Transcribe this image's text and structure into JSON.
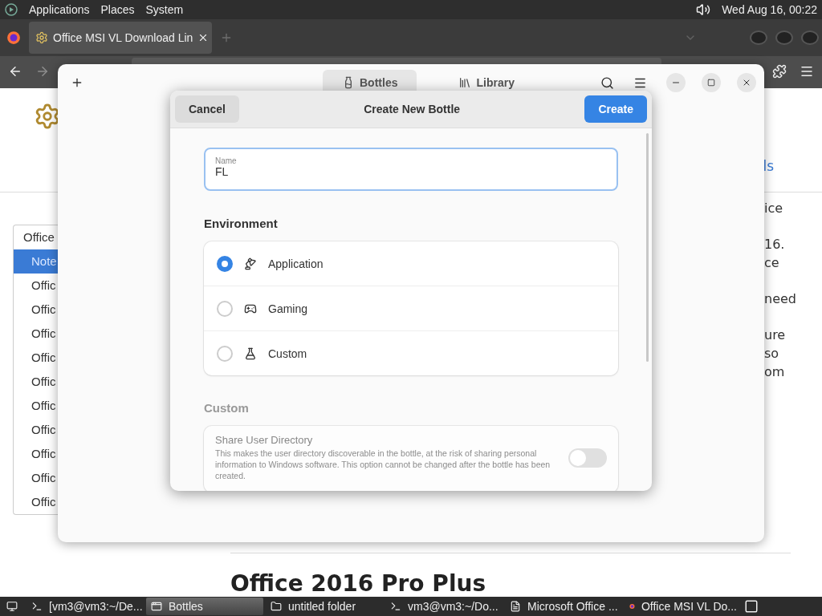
{
  "top_panel": {
    "menus": [
      "Applications",
      "Places",
      "System"
    ],
    "clock": "Wed Aug 16, 00:22"
  },
  "browser": {
    "tabs": [
      {
        "title": "Office MSI VL Download Lin",
        "selected": true
      }
    ],
    "page": {
      "link": "ls",
      "list": [
        {
          "label": "Office",
          "kind": "group",
          "selected": false
        },
        {
          "label": "Note",
          "kind": "option",
          "selected": true
        },
        {
          "label": "Offic",
          "kind": "option",
          "selected": false
        },
        {
          "label": "Offic",
          "kind": "option",
          "selected": false
        },
        {
          "label": "Offic",
          "kind": "option",
          "selected": false
        },
        {
          "label": "Offic",
          "kind": "option",
          "selected": false
        },
        {
          "label": "Offic",
          "kind": "option",
          "selected": false
        },
        {
          "label": "Offic",
          "kind": "option",
          "selected": false
        },
        {
          "label": "Offic",
          "kind": "option",
          "selected": false
        },
        {
          "label": "Offic",
          "kind": "option",
          "selected": false
        },
        {
          "label": "Offic",
          "kind": "option",
          "selected": false
        },
        {
          "label": "Offic",
          "kind": "option",
          "selected": false
        }
      ],
      "paragraphs": [
        [
          "ice"
        ],
        [
          "16.",
          "ce"
        ],
        [
          "need"
        ],
        [
          "ure",
          "so",
          "om"
        ]
      ],
      "heading": "Office 2016 Pro Plus"
    }
  },
  "bottles_window": {
    "tabs": [
      {
        "label": "Bottles",
        "kind": "bottles",
        "selected": true
      },
      {
        "label": "Library",
        "kind": "library",
        "selected": false
      }
    ]
  },
  "dialog": {
    "title": "Create New Bottle",
    "cancel": "Cancel",
    "create": "Create",
    "name_field": {
      "label": "Name",
      "value": "FL"
    },
    "environment": {
      "heading": "Environment",
      "options": [
        {
          "label": "Application",
          "kind": "application",
          "selected": true
        },
        {
          "label": "Gaming",
          "kind": "gaming",
          "selected": false
        },
        {
          "label": "Custom",
          "kind": "custom",
          "selected": false
        }
      ]
    },
    "custom": {
      "heading": "Custom",
      "disabled": true,
      "rows": [
        {
          "title": "Share User Directory",
          "description": "This makes the user directory discoverable in the bottle, at the risk of sharing personal information to Windows software. This option cannot be changed after the bottle has been created.",
          "on": false
        }
      ]
    }
  },
  "taskbar": {
    "items": [
      {
        "label": "[vm3@vm3:~/De...",
        "kind": "terminal",
        "selected": false
      },
      {
        "label": "Bottles",
        "kind": "window",
        "selected": true
      },
      {
        "label": "untitled folder",
        "kind": "folder",
        "selected": false
      },
      {
        "label": "vm3@vm3:~/Do...",
        "kind": "terminal",
        "selected": false
      },
      {
        "label": "Microsoft Office ...",
        "kind": "file",
        "selected": false
      },
      {
        "label": "Office MSI VL Do...",
        "kind": "firefox",
        "selected": false
      }
    ]
  }
}
